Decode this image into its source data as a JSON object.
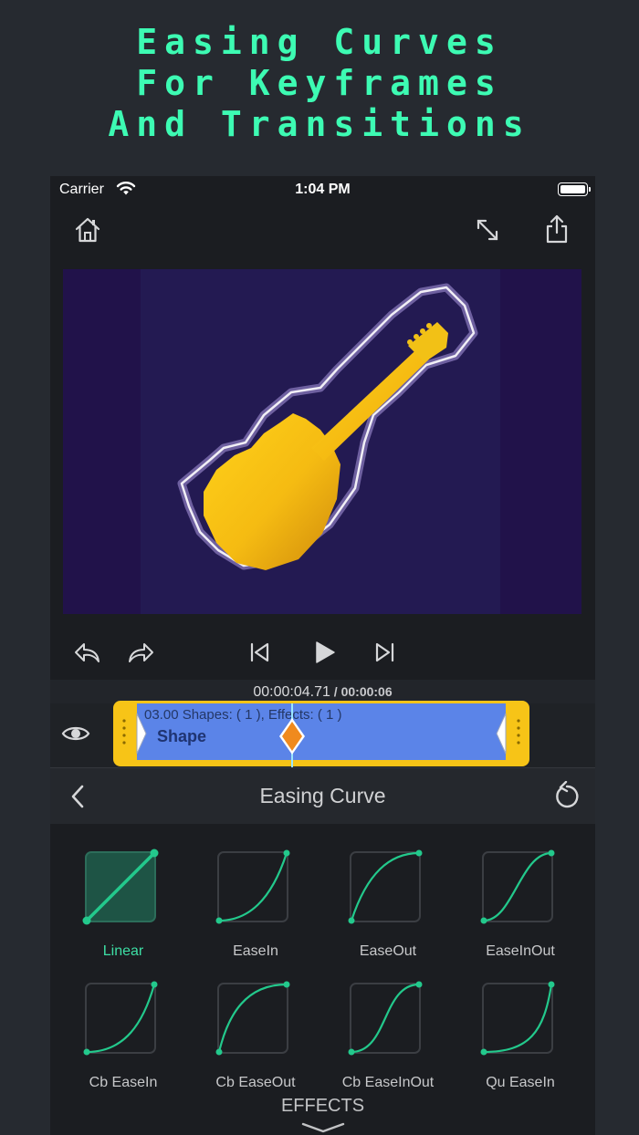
{
  "promo": {
    "line1": "Easing Curves",
    "line2": "For Keyframes",
    "line3": "And Transitions"
  },
  "status_bar": {
    "carrier": "Carrier",
    "time": "1:04 PM"
  },
  "toolbar": {
    "home_icon": "home-icon",
    "fullscreen_icon": "expand-icon",
    "share_icon": "share-icon"
  },
  "playback": {
    "current_time": "00:00:04.71",
    "separator": " / ",
    "total_time": "00:00:06"
  },
  "timeline": {
    "clip_info": "03.00  Shapes: ( 1 ),  Effects: ( 1 )",
    "clip_title": "Shape"
  },
  "panel": {
    "title": "Easing Curve"
  },
  "curves": [
    {
      "label": "Linear",
      "selected": true
    },
    {
      "label": "EaseIn",
      "selected": false
    },
    {
      "label": "EaseOut",
      "selected": false
    },
    {
      "label": "EaseInOut",
      "selected": false
    },
    {
      "label": "Cb EaseIn",
      "selected": false
    },
    {
      "label": "Cb EaseOut",
      "selected": false
    },
    {
      "label": "Cb EaseInOut",
      "selected": false
    },
    {
      "label": "Qu EaseIn",
      "selected": false
    }
  ],
  "footer": {
    "effects_label": "EFFECTS"
  },
  "colors": {
    "accent": "#3dfbb3",
    "curve": "#23c98c",
    "clip_border": "#f7c417",
    "clip_fill": "#5b84e8",
    "keyframe": "#f08a1e"
  }
}
